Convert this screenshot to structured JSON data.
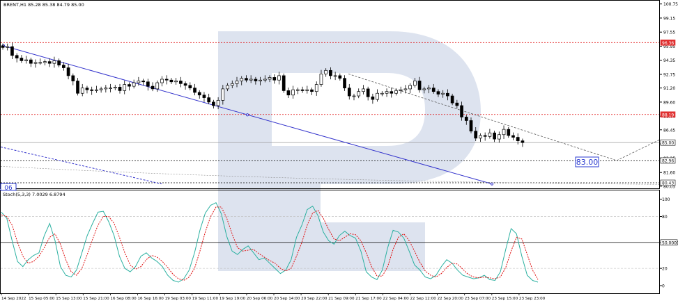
{
  "colors": {
    "candle": "#000000",
    "trendline": "#3333cc",
    "stoch_main": "#2ab0a0",
    "stoch_signal": "#e01010",
    "level_red": "#e01010",
    "level_black": "#000000",
    "watermark": "#dde3ef",
    "axis_text": "#000000",
    "price_label_red": "#e03030",
    "price_label_dark": "#202020",
    "target_box": "#2a3ad0"
  },
  "chart_data": [
    {
      "type": "candlestick",
      "title": "BRENT,H1  85.28 85.38 84.79 85.00",
      "ylim": [
        79.8,
        101.2
      ],
      "y_ticks": [
        "100.75",
        "99.15",
        "97.55",
        "95.95",
        "94.35",
        "92.75",
        "91.20",
        "89.60",
        "88.00",
        "86.45",
        "84.85",
        "83.25",
        "81.60",
        "80.05"
      ],
      "x_ticks": [
        "14 Sep 2022",
        "15 Sep 05:00",
        "15 Sep 13:00",
        "15 Sep 21:00",
        "16 Sep 08:00",
        "16 Sep 16:00",
        "19 Sep 03:00",
        "19 Sep 11:00",
        "19 Sep 19:00",
        "20 Sep 06:00",
        "20 Sep 14:00",
        "20 Sep 22:00",
        "21 Sep 09:00",
        "21 Sep 17:00",
        "22 Sep 04:00",
        "22 Sep 12:00",
        "22 Sep 20:00",
        "23 Sep 07:00",
        "23 Sep 15:00",
        "23 Sep 23:00"
      ],
      "close_series": [
        95.8,
        95.9,
        94.9,
        94.6,
        94.3,
        94.4,
        94.0,
        94.1,
        94.1,
        94.2,
        94.0,
        94.3,
        93.8,
        93.5,
        92.6,
        92.0,
        90.6,
        91.2,
        91.0,
        90.9,
        91.0,
        91.1,
        91.2,
        91.2,
        91.3,
        90.9,
        91.6,
        91.4,
        91.8,
        92.0,
        91.9,
        91.4,
        91.1,
        91.8,
        92.2,
        92.1,
        91.9,
        92.0,
        91.7,
        91.5,
        91.2,
        90.7,
        90.4,
        90.1,
        89.6,
        89.2,
        89.8,
        91.1,
        91.5,
        91.7,
        92.0,
        92.3,
        92.1,
        92.2,
        92.0,
        92.1,
        92.2,
        92.4,
        92.1,
        92.6,
        90.9,
        90.4,
        91.0,
        91.0,
        90.9,
        91.0,
        90.8,
        91.6,
        92.8,
        93.2,
        92.6,
        92.6,
        92.3,
        91.2,
        90.3,
        90.3,
        90.8,
        91.1,
        90.2,
        89.9,
        90.6,
        90.6,
        90.8,
        90.6,
        90.9,
        91.0,
        91.1,
        91.5,
        92.0,
        91.0,
        91.1,
        91.2,
        90.8,
        90.5,
        90.6,
        90.3,
        89.5,
        89.2,
        87.9,
        87.5,
        86.3,
        85.5,
        85.8,
        85.7,
        86.1,
        85.4,
        85.9,
        86.5,
        85.8,
        85.6,
        85.2,
        85.0
      ],
      "price_labels": [
        {
          "text": "96.36",
          "style": "red"
        },
        {
          "text": "88.19",
          "style": "red"
        },
        {
          "text": "85.00",
          "style": "dark"
        },
        {
          "text": "82.96",
          "style": "dark"
        },
        {
          "text": "80.43",
          "style": "dark"
        }
      ],
      "levels": [
        {
          "value": 96.36,
          "color": "red",
          "dash": "short"
        },
        {
          "value": 88.19,
          "color": "red",
          "dash": "short"
        },
        {
          "value": 85.0,
          "color": "grey",
          "dash": "none"
        },
        {
          "value": 82.96,
          "color": "black",
          "dash": "short"
        },
        {
          "value": 80.43,
          "color": "black",
          "dash": "short"
        }
      ],
      "target_label": "83.00",
      "left_edge_label": "06"
    },
    {
      "type": "line",
      "title": "Stoch(5,3,3) 7.0029 6.8794",
      "ylim": [
        0,
        100
      ],
      "y_ticks": [
        "100",
        "80",
        "50.0000",
        "20",
        "0"
      ],
      "series": [
        {
          "color": "stoch_main",
          "values": [
            85,
            78,
            52,
            28,
            22,
            30,
            35,
            38,
            58,
            72,
            52,
            22,
            12,
            10,
            18,
            38,
            58,
            72,
            85,
            86,
            74,
            58,
            34,
            20,
            16,
            22,
            34,
            38,
            32,
            28,
            22,
            12,
            6,
            4,
            8,
            18,
            38,
            64,
            84,
            93,
            96,
            83,
            57,
            40,
            36,
            42,
            46,
            38,
            30,
            32,
            26,
            20,
            14,
            18,
            30,
            56,
            70,
            88,
            92,
            81,
            62,
            52,
            48,
            58,
            63,
            58,
            55,
            40,
            16,
            10,
            7,
            18,
            44,
            64,
            62,
            55,
            40,
            24,
            18,
            10,
            8,
            12,
            22,
            30,
            26,
            18,
            12,
            10,
            8,
            9,
            12,
            7,
            6,
            16,
            42,
            66,
            60,
            34,
            12,
            6,
            4
          ]
        },
        {
          "color": "stoch_signal",
          "values": [
            82,
            80,
            70,
            50,
            34,
            26,
            28,
            34,
            44,
            56,
            60,
            48,
            30,
            16,
            12,
            20,
            36,
            54,
            70,
            80,
            80,
            72,
            56,
            38,
            24,
            19,
            22,
            30,
            35,
            33,
            28,
            21,
            13,
            8,
            6,
            10,
            20,
            40,
            62,
            80,
            91,
            91,
            78,
            60,
            44,
            40,
            41,
            42,
            37,
            33,
            29,
            26,
            20,
            17,
            20,
            34,
            50,
            70,
            84,
            87,
            78,
            65,
            54,
            52,
            56,
            60,
            59,
            52,
            38,
            22,
            11,
            11,
            22,
            42,
            56,
            60,
            52,
            40,
            27,
            17,
            12,
            10,
            14,
            21,
            26,
            25,
            19,
            13,
            10,
            9,
            10,
            9,
            8,
            10,
            21,
            40,
            56,
            54,
            36,
            18,
            7
          ]
        }
      ],
      "levels": [
        80,
        50,
        20
      ]
    }
  ]
}
